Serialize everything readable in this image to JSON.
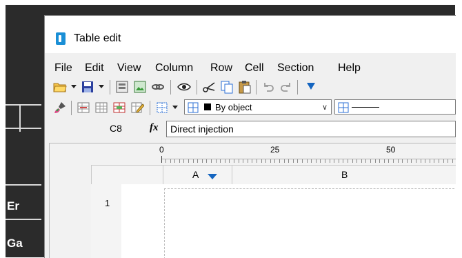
{
  "background": {
    "cells": [
      "Er",
      "Ga"
    ]
  },
  "window": {
    "title": "Table edit",
    "app_icon": "app-icon"
  },
  "menu": [
    "File",
    "Edit",
    "View",
    "Column",
    "Row",
    "Cell",
    "Section",
    "Help"
  ],
  "toolbar1": {
    "icons": [
      "open-folder-icon",
      "save-icon",
      "properties-icon",
      "image-icon",
      "link-icon",
      "preview-eye-icon",
      "cut-scissors-icon",
      "copy-icon",
      "paste-icon",
      "undo-icon",
      "redo-icon"
    ]
  },
  "toolbar2": {
    "icons": [
      "paint-brush-icon",
      "insert-row-icon",
      "insert-column-icon",
      "merge-cells-icon",
      "edit-cell-icon",
      "border-grid-icon"
    ],
    "border_combo": {
      "value": "By object"
    }
  },
  "formula_bar": {
    "cell_ref": "C8",
    "fx_label": "fx",
    "value": "Direct injection"
  },
  "ruler": {
    "marks": [
      "0",
      "25",
      "50"
    ]
  },
  "columns": [
    "A",
    "B"
  ],
  "rows": [
    "1"
  ],
  "colors": {
    "accent": "#1565c0",
    "frame": "#2b2b2b",
    "window_bg": "#f0f0f0"
  }
}
